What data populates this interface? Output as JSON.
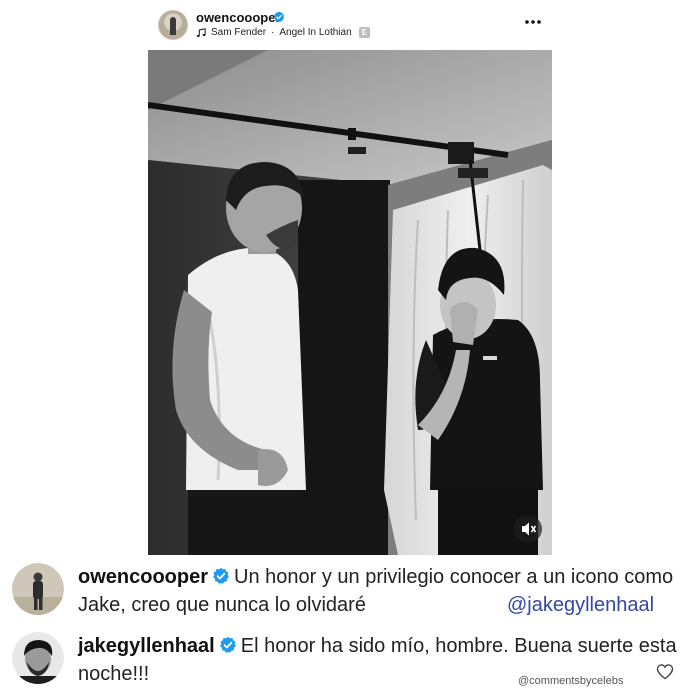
{
  "post": {
    "username": "owencoooper",
    "music": {
      "artist": "Sam Fender",
      "separator": "·",
      "song": "Angel In Lothian",
      "explicit_badge": "E"
    },
    "icons": {
      "more": "more-options-icon",
      "music": "music-note-icon",
      "verified": "verified-badge-icon",
      "mute": "muted-speaker-icon"
    }
  },
  "comments": [
    {
      "username": "owencoooper",
      "text": "Un honor y un privilegio conocer a un icono como Jake, creo que nunca lo olvidaré",
      "mention": "@jakegyllenhaal"
    },
    {
      "username": "jakegyllenhaal",
      "text": "El honor ha sido mío, hombre. Buena suerte esta noche!!!"
    }
  ],
  "watermark": "@commentsbycelebs",
  "colors": {
    "verified": "#1d9bf0",
    "mention": "#3447a6",
    "text": "#222222"
  }
}
